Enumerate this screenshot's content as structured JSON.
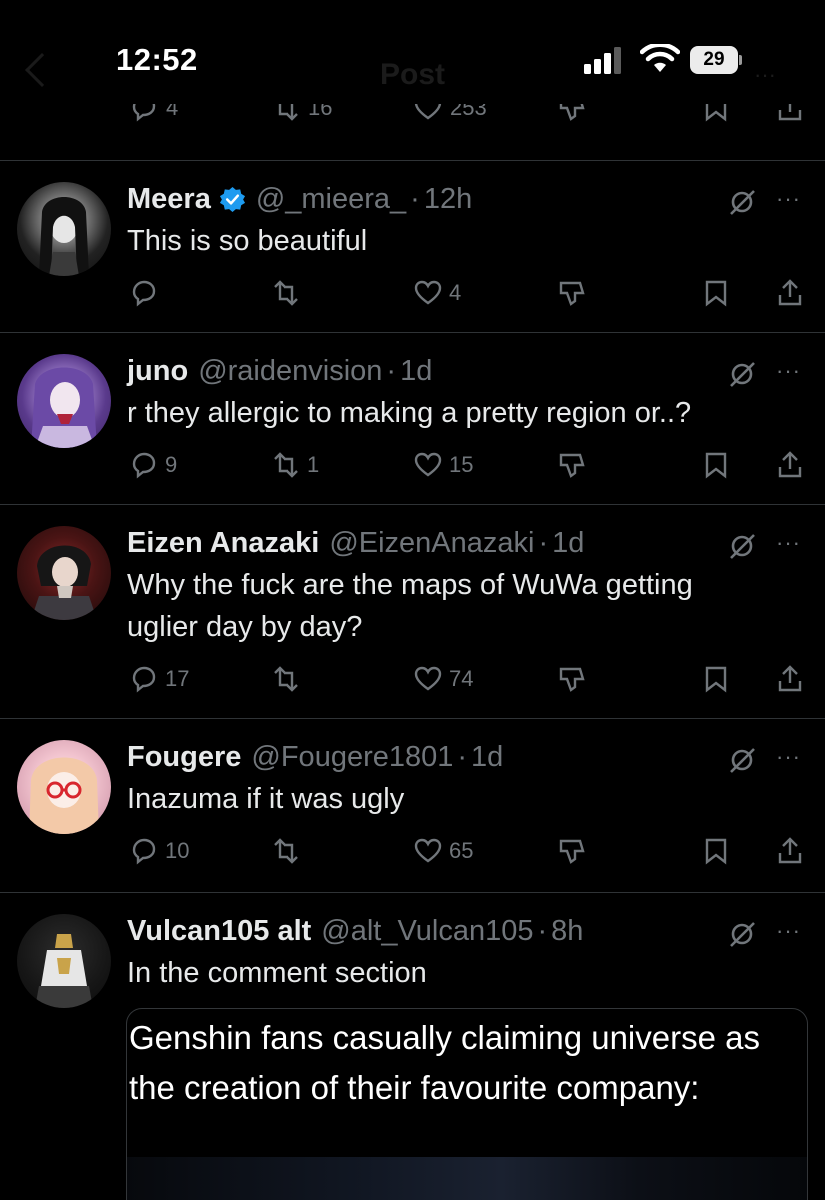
{
  "status_bar": {
    "time": "12:52",
    "battery": "29",
    "header_title": "Post"
  },
  "top_actions": {
    "replies": "4",
    "reposts": "16",
    "likes": "253"
  },
  "tweets": [
    {
      "name": "Meera",
      "verified": true,
      "handle": "@_mieera_",
      "time": "12h",
      "text": "This is so beautiful",
      "replies": "",
      "reposts": "",
      "likes": "4"
    },
    {
      "name": "juno",
      "verified": false,
      "handle": "@raidenvision",
      "time": "1d",
      "text": "r they allergic to making a pretty region or..?",
      "replies": "9",
      "reposts": "1",
      "likes": "15"
    },
    {
      "name": "Eizen Anazaki",
      "verified": false,
      "handle": "@EizenAnazaki",
      "time": "1d",
      "text": "Why the fuck are the maps of WuWa getting uglier day by day?",
      "replies": "17",
      "reposts": "",
      "likes": "74"
    },
    {
      "name": "Fougere",
      "verified": false,
      "handle": "@Fougere1801",
      "time": "1d",
      "text": "Inazuma if it was ugly",
      "replies": "10",
      "reposts": "",
      "likes": "65"
    },
    {
      "name": "Vulcan105 alt",
      "verified": false,
      "handle": "@alt_Vulcan105",
      "time": "8h",
      "text": "In the comment section",
      "quote_text": "Genshin fans casually claiming universe as the creation of their favourite company:"
    }
  ],
  "separator": "·",
  "more_glyph": "···",
  "colors": {
    "background": "#000000",
    "text": "#e7e9ea",
    "muted": "#71767b",
    "divider": "#2f3336",
    "verified": "#1d9bf0"
  }
}
